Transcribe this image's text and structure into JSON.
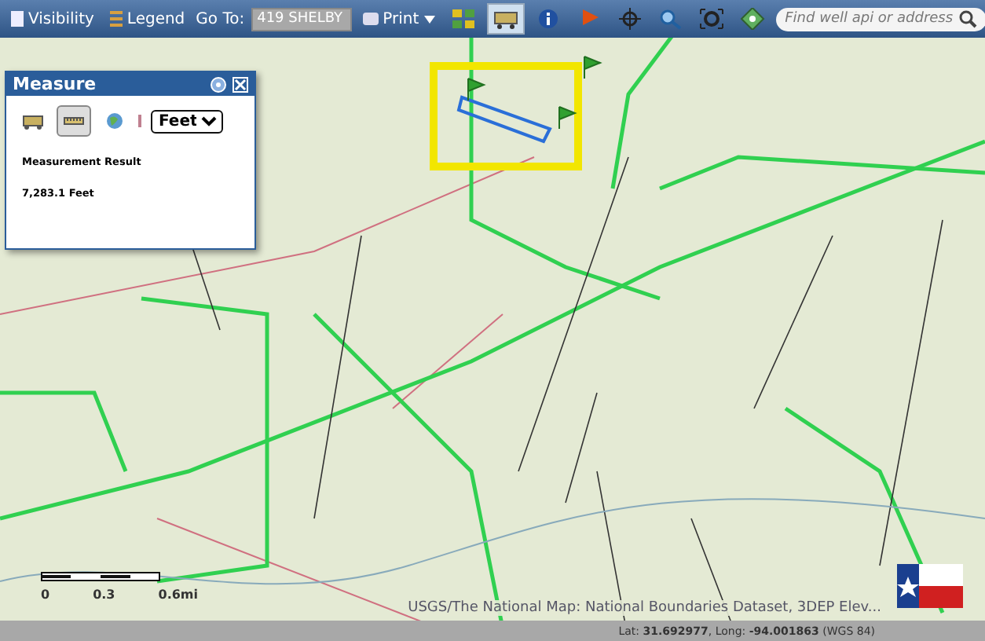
{
  "toolbar": {
    "visibility": "Visibility",
    "legend": "Legend",
    "goto_label": "Go To:",
    "goto_value": "419 SHELBY",
    "print": "Print",
    "tools": [
      {
        "kind": "grid",
        "selected": false
      },
      {
        "kind": "truck",
        "selected": true
      },
      {
        "kind": "info",
        "selected": false
      },
      {
        "kind": "flag",
        "selected": false
      },
      {
        "kind": "crosshair",
        "selected": false
      },
      {
        "kind": "zoom",
        "selected": false
      },
      {
        "kind": "extent",
        "selected": false
      },
      {
        "kind": "diamond",
        "selected": false
      }
    ],
    "search": {
      "placeholder": "Find well api or address"
    }
  },
  "measure": {
    "title": "Measure",
    "tools": [
      {
        "kind": "area",
        "selected": false
      },
      {
        "kind": "distance",
        "selected": true
      },
      {
        "kind": "location",
        "selected": false
      }
    ],
    "unit": "Feet",
    "result_label": "Measurement Result",
    "result_value": "7,283.1 Feet"
  },
  "map": {
    "attribution": "USGS/The National Map: National Boundaries Dataset, 3DEP Elev...",
    "scale": [
      "0",
      "0.3",
      "0.6mi"
    ]
  },
  "status_bar": {
    "coordinates": "Lat: **31.692977**, Long: **-94.001863** (WGS 84)"
  }
}
